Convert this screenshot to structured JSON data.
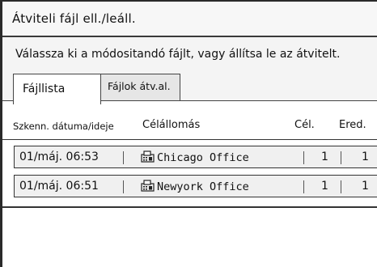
{
  "window": {
    "title": "Átviteli fájl ell./leáll."
  },
  "instruction": "Válassza ki a módositandó fájlt, vagy állítsa le az átvitelt.",
  "tabs": [
    {
      "label": "Fájllista",
      "active": true
    },
    {
      "label": "Fájlok átv.al.",
      "active": false
    }
  ],
  "table": {
    "columns": {
      "date": "Szkenn. dátuma/ideje",
      "destination": "Célállomás",
      "cel": "Cél.",
      "ered": "Ered."
    },
    "rows": [
      {
        "datetime": "01/máj. 06:53",
        "destination": "Chicago Office",
        "dest_icon": "fax-destination-icon",
        "cel": "1",
        "ered": "1"
      },
      {
        "datetime": "01/máj. 06:51",
        "destination": "Newyork Office",
        "dest_icon": "fax-destination-icon",
        "cel": "1",
        "ered": "1"
      }
    ]
  }
}
